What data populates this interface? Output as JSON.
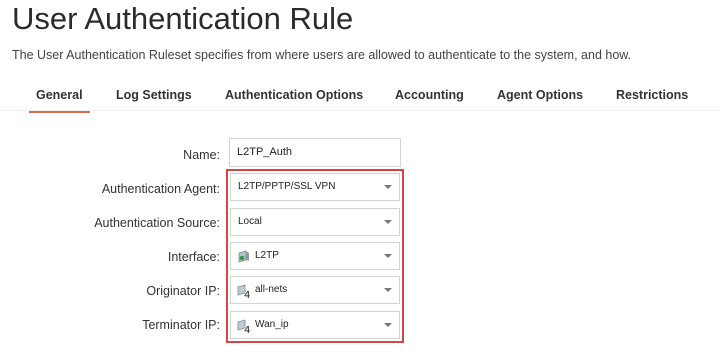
{
  "page": {
    "title": "User Authentication Rule",
    "description": "The User Authentication Ruleset specifies from where users are allowed to authenticate to the system, and how."
  },
  "tabs": [
    {
      "label": "General",
      "active": true
    },
    {
      "label": "Log Settings",
      "active": false
    },
    {
      "label": "Authentication Options",
      "active": false
    },
    {
      "label": "Accounting",
      "active": false
    },
    {
      "label": "Agent Options",
      "active": false
    },
    {
      "label": "Restrictions",
      "active": false
    }
  ],
  "form": {
    "name": {
      "label": "Name:",
      "value": "L2TP_Auth"
    },
    "authentication_agent": {
      "label": "Authentication Agent:",
      "value": "L2TP/PPTP/SSL VPN"
    },
    "authentication_source": {
      "label": "Authentication Source:",
      "value": "Local"
    },
    "interface": {
      "label": "Interface:",
      "value": "L2TP",
      "icon": "interface-icon"
    },
    "originator_ip": {
      "label": "Originator IP:",
      "value": "all-nets",
      "icon": "ipv4-address-icon"
    },
    "terminator_ip": {
      "label": "Terminator IP:",
      "value": "Wan_ip",
      "icon": "ipv4-address-icon"
    }
  },
  "colors": {
    "accent": "#d66c4a",
    "highlight": "#d94545"
  }
}
